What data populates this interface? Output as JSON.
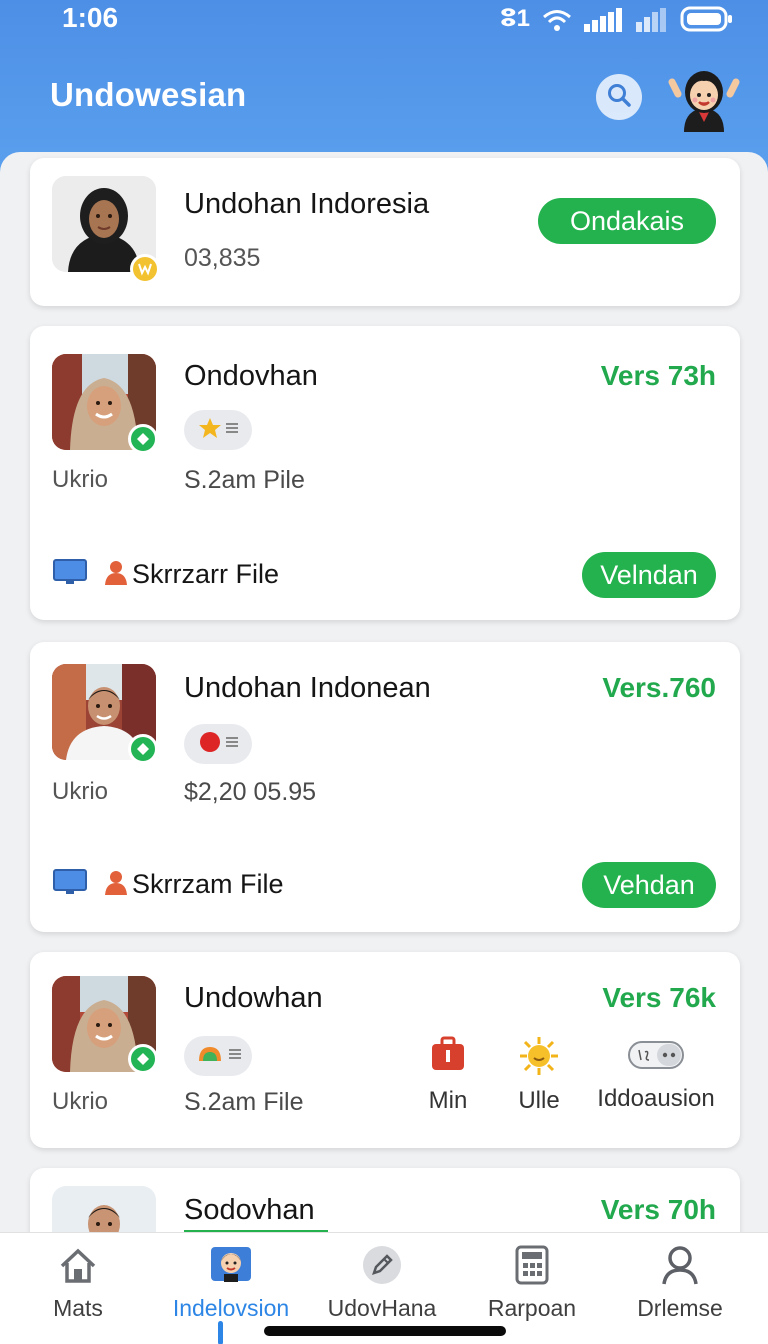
{
  "status_bar": {
    "time": "1:06",
    "signal_label": "ⵓ1"
  },
  "header": {
    "title": "Undowesian"
  },
  "cards": [
    {
      "name": "Undohan Indoresia",
      "sub": "03,835",
      "button": "Ondakais"
    },
    {
      "name": "Ondovhan",
      "side": "Ukrio",
      "sub": "S.2am Pile",
      "vers": "Vers 73h",
      "footer": "Skrrzarr File",
      "button": "Velndan"
    },
    {
      "name": "Undohan Indonean",
      "side": "Ukrio",
      "sub": "$2,20  05.95",
      "vers": "Vers.760",
      "footer": "Skrrzam File",
      "button": "Vehdan"
    },
    {
      "name": "Undowhan",
      "side": "Ukrio",
      "sub": "S.2am File",
      "vers": "Vers 76k",
      "extras": [
        "Min",
        "Ulle",
        "Iddoausion"
      ]
    },
    {
      "name": "Sodovhan",
      "vers": "Vers 70h"
    }
  ],
  "nav": [
    {
      "label": "Mats",
      "icon": "house-icon"
    },
    {
      "label": "Indelovsion",
      "icon": "character-icon",
      "active": true
    },
    {
      "label": "UdovHana",
      "icon": "pencil-icon"
    },
    {
      "label": "Rarpoan",
      "icon": "calculator-icon"
    },
    {
      "label": "Drlemse",
      "icon": "person-icon"
    }
  ],
  "colors": {
    "header": "#4d8fe6",
    "accent_green": "#24b24e",
    "active_nav": "#2d86e5"
  }
}
